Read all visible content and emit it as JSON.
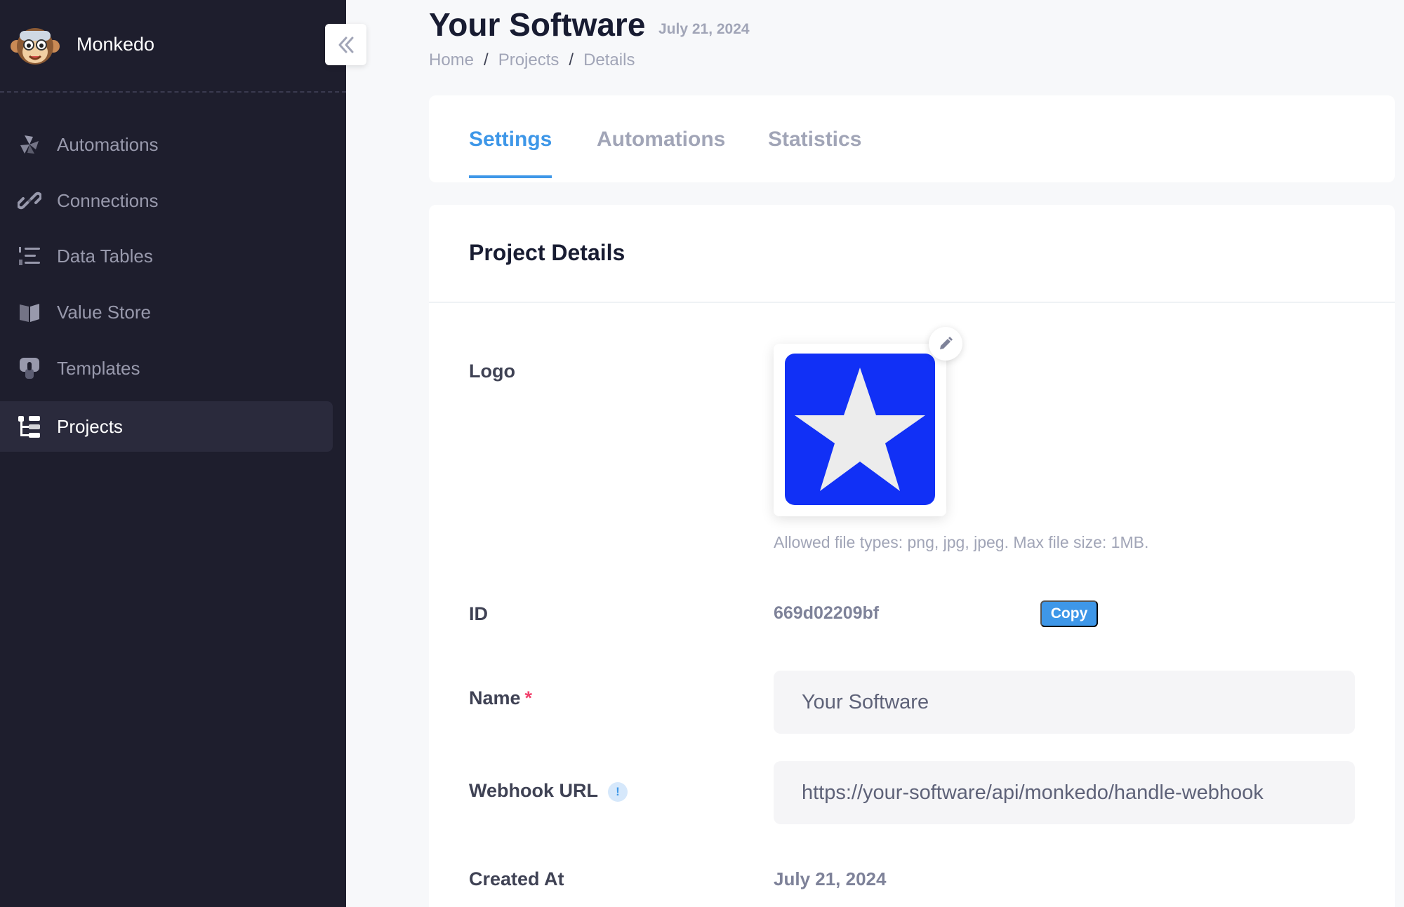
{
  "brand": {
    "name": "Monkedo"
  },
  "sidebar": {
    "items": [
      {
        "label": "Automations",
        "icon": "automations-icon",
        "active": false
      },
      {
        "label": "Connections",
        "icon": "link-icon",
        "active": false
      },
      {
        "label": "Data Tables",
        "icon": "numbered-list-icon",
        "active": false
      },
      {
        "label": "Value Store",
        "icon": "book-icon",
        "active": false
      },
      {
        "label": "Templates",
        "icon": "template-icon",
        "active": false
      },
      {
        "label": "Projects",
        "icon": "tree-icon",
        "active": true
      }
    ]
  },
  "header": {
    "title": "Your Software",
    "date": "July 21, 2024",
    "breadcrumb": [
      "Home",
      "Projects",
      "Details"
    ]
  },
  "tabs": [
    {
      "label": "Settings",
      "active": true
    },
    {
      "label": "Automations",
      "active": false
    },
    {
      "label": "Statistics",
      "active": false
    }
  ],
  "details": {
    "title": "Project Details",
    "logo_label": "Logo",
    "logo_hint": "Allowed file types: png, jpg, jpeg. Max file size: 1MB.",
    "id_label": "ID",
    "id_value": "669d02209bf",
    "copy_label": "Copy",
    "name_label": "Name",
    "required_mark": "*",
    "name_value": "Your Software",
    "webhook_label": "Webhook URL",
    "info_mark": "!",
    "webhook_value": "https://your-software/api/monkedo/handle-webhook",
    "created_label": "Created At",
    "created_value": "July 21, 2024"
  },
  "colors": {
    "sidebar_bg": "#1e1e2d",
    "accent": "#3e97e8",
    "logo_blue": "#1130f6",
    "required": "#f1416c"
  }
}
